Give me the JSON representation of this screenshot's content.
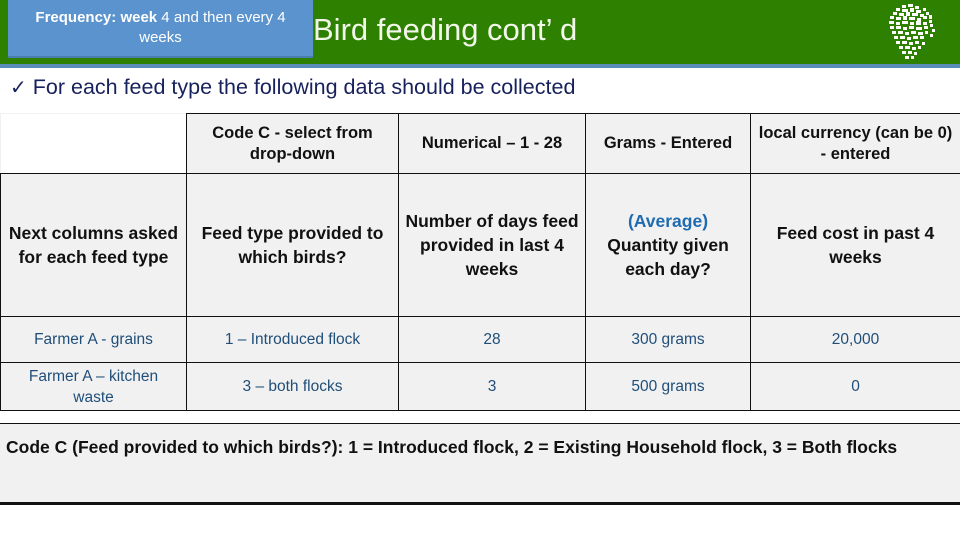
{
  "header": {
    "title": "Bird feeding cont’  d",
    "badge": {
      "bold_part": "Frequency: week",
      "regular_part": " 4 and then every 4 weeks"
    },
    "logo_name": "africa-map-logo",
    "bar_color": "#2d8000",
    "badge_color": "#5b93ce",
    "underline_color": "#5b8db8"
  },
  "subtitle": {
    "bullet": "✓",
    "text": "For each feed type the following data should be collected",
    "color": "#17215c"
  },
  "table": {
    "type_row": [
      "",
      "Code C - select from drop-down",
      "Numerical – 1 - 28",
      "Grams - Entered",
      "local currency (can be 0) - entered"
    ],
    "question_row": {
      "label": "Next columns asked for each feed type",
      "cells": [
        {
          "text": "Feed type provided to which birds?"
        },
        {
          "text": "Number of days feed provided in last 4 weeks"
        },
        {
          "prefix": "(Average)",
          "prefix_color": "#1f6bb0",
          "text": "Quantity given each day?"
        },
        {
          "text": "Feed cost in past 4 weeks"
        }
      ]
    },
    "data_rows": [
      {
        "label": "Farmer A - grains",
        "label_bold_token": "A",
        "values": [
          "1 – Introduced flock",
          "28",
          "300 grams",
          "20,000"
        ]
      },
      {
        "label": "Farmer A – kitchen waste",
        "label_bold_token": "A",
        "values": [
          "3 – both flocks",
          "3",
          "500 grams",
          "0"
        ]
      }
    ],
    "data_text_color": "#1f4e79"
  },
  "footer": {
    "note": "Code C (Feed provided to which birds?): 1 = Introduced flock, 2 = Existing Household flock, 3 = Both flocks"
  }
}
